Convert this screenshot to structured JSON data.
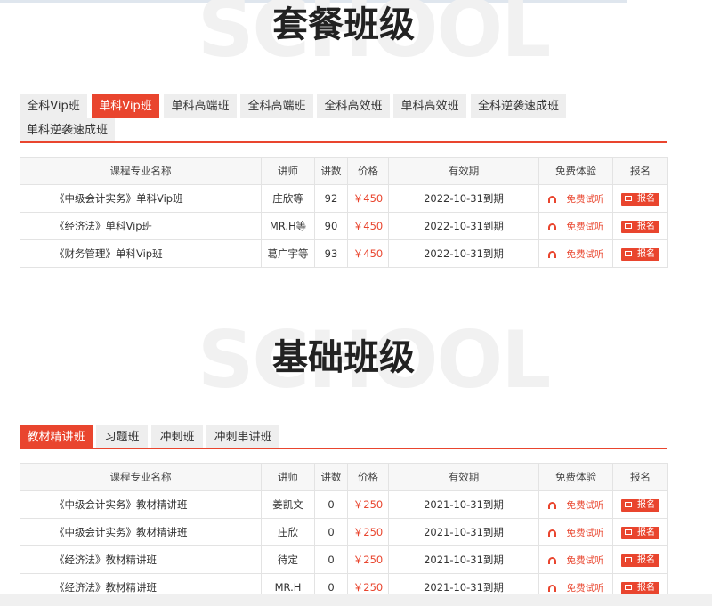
{
  "sections": [
    {
      "watermark": "SCHOOL",
      "title": "套餐班级",
      "tabs": [
        "全科Vip班",
        "单科Vip班",
        "单科高端班",
        "全科高端班",
        "全科高效班",
        "单科高效班",
        "全科逆袭速成班",
        "单科逆袭速成班"
      ],
      "active_tab": 1,
      "headers": [
        "课程专业名称",
        "讲师",
        "讲数",
        "价格",
        "有效期",
        "免费体验",
        "报名"
      ],
      "rows": [
        {
          "name": "《中级会计实务》单科Vip班",
          "teacher": "庄欣等",
          "lectures": "92",
          "price": "￥450",
          "expiry": "2022-10-31到期",
          "trial": "免费试听",
          "signup": "报名"
        },
        {
          "name": "《经济法》单科Vip班",
          "teacher": "MR.H等",
          "lectures": "90",
          "price": "￥450",
          "expiry": "2022-10-31到期",
          "trial": "免费试听",
          "signup": "报名"
        },
        {
          "name": "《财务管理》单科Vip班",
          "teacher": "葛广宇等",
          "lectures": "93",
          "price": "￥450",
          "expiry": "2022-10-31到期",
          "trial": "免费试听",
          "signup": "报名"
        }
      ]
    },
    {
      "watermark": "SCHOOL",
      "title": "基础班级",
      "tabs": [
        "教材精讲班",
        "习题班",
        "冲刺班",
        "冲刺串讲班"
      ],
      "active_tab": 0,
      "headers": [
        "课程专业名称",
        "讲师",
        "讲数",
        "价格",
        "有效期",
        "免费体验",
        "报名"
      ],
      "rows": [
        {
          "name": "《中级会计实务》教材精讲班",
          "teacher": "姜凯文",
          "lectures": "0",
          "price": "￥250",
          "expiry": "2021-10-31到期",
          "trial": "免费试听",
          "signup": "报名"
        },
        {
          "name": "《中级会计实务》教材精讲班",
          "teacher": "庄欣",
          "lectures": "0",
          "price": "￥250",
          "expiry": "2021-10-31到期",
          "trial": "免费试听",
          "signup": "报名"
        },
        {
          "name": "《经济法》教材精讲班",
          "teacher": "待定",
          "lectures": "0",
          "price": "￥250",
          "expiry": "2021-10-31到期",
          "trial": "免费试听",
          "signup": "报名"
        },
        {
          "name": "《经济法》教材精讲班",
          "teacher": "MR.H",
          "lectures": "0",
          "price": "￥250",
          "expiry": "2021-10-31到期",
          "trial": "免费试听",
          "signup": "报名"
        }
      ]
    }
  ],
  "colors": {
    "accent": "#e9452e",
    "tab_bg": "#eeeeee",
    "header_bg": "#f7f7f7"
  },
  "icons": {
    "trial": "headphones-icon",
    "signup": "cart-icon"
  }
}
